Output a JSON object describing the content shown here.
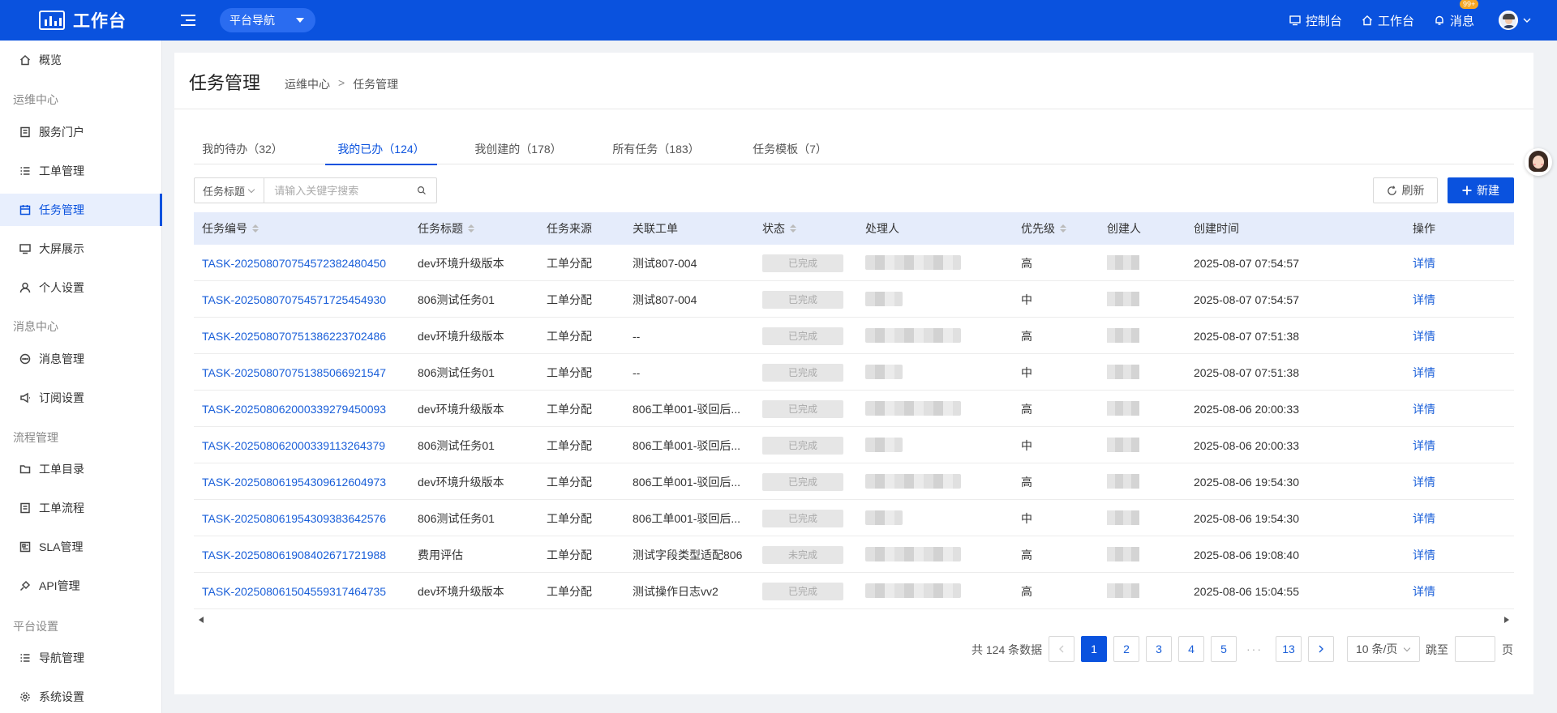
{
  "header": {
    "brand": "工作台",
    "platform_nav": "平台导航",
    "links": [
      {
        "label": "控制台",
        "icon": "monitor-icon"
      },
      {
        "label": "工作台",
        "icon": "home-icon"
      },
      {
        "label": "消息",
        "icon": "bell-icon",
        "badge": "99+"
      }
    ],
    "brand_color": "#0a52de"
  },
  "sidebar": {
    "overview": "概览",
    "groups": [
      {
        "title": "运维中心",
        "items": [
          "服务门户",
          "工单管理",
          "任务管理",
          "大屏展示",
          "个人设置"
        ]
      },
      {
        "title": "消息中心",
        "items": [
          "消息管理",
          "订阅设置"
        ]
      },
      {
        "title": "流程管理",
        "items": [
          "工单目录",
          "工单流程",
          "SLA管理",
          "API管理"
        ]
      },
      {
        "title": "平台设置",
        "items": [
          "导航管理",
          "系统设置"
        ]
      }
    ],
    "active": "任务管理"
  },
  "page": {
    "title": "任务管理",
    "breadcrumb": [
      "运维中心",
      ">",
      "任务管理"
    ]
  },
  "tabs": [
    "我的待办（32）",
    "我的已办（124）",
    "我创建的（178）",
    "所有任务（183）",
    "任务模板（7）"
  ],
  "active_tab": 1,
  "filter": {
    "field": "任务标题",
    "placeholder": "请输入关键字搜索"
  },
  "actions": {
    "refresh": "刷新",
    "new": "新建"
  },
  "table": {
    "columns": [
      "任务编号",
      "任务标题",
      "任务来源",
      "关联工单",
      "状态",
      "处理人",
      "优先级",
      "创建人",
      "创建时间",
      "操作"
    ],
    "rows": [
      {
        "id": "TASK-20250807075457238248045 0",
        "title": "dev环境升级版本",
        "source": "工单分配",
        "ticket": "测试807-004",
        "status": "已完成",
        "priority": "高",
        "time": "2025-08-07 07:54:57",
        "action": "详情"
      },
      {
        "id": "TASK-20250807075457172545493 0",
        "title": "806测试任务01",
        "source": "工单分配",
        "ticket": "测试807-004",
        "status": "已完成",
        "priority": "中",
        "time": "2025-08-07 07:54:57",
        "action": "详情"
      },
      {
        "id": "TASK-20250807075138622370248 6",
        "title": "dev环境升级版本",
        "source": "工单分配",
        "ticket": "--",
        "status": "已完成",
        "priority": "高",
        "time": "2025-08-07 07:51:38",
        "action": "详情"
      },
      {
        "id": "TASK-20250807075138506692154 7",
        "title": "806测试任务01",
        "source": "工单分配",
        "ticket": "--",
        "status": "已完成",
        "priority": "中",
        "time": "2025-08-07 07:51:38",
        "action": "详情"
      },
      {
        "id": "TASK-20250806200033927945009 3",
        "title": "dev环境升级版本",
        "source": "工单分配",
        "ticket": "806工单001-驳回后...",
        "status": "已完成",
        "priority": "高",
        "time": "2025-08-06 20:00:33",
        "action": "详情"
      },
      {
        "id": "TASK-20250806200033911326437 9",
        "title": "806测试任务01",
        "source": "工单分配",
        "ticket": "806工单001-驳回后...",
        "status": "已完成",
        "priority": "中",
        "time": "2025-08-06 20:00:33",
        "action": "详情"
      },
      {
        "id": "TASK-20250806195430961260497 3",
        "title": "dev环境升级版本",
        "source": "工单分配",
        "ticket": "806工单001-驳回后...",
        "status": "已完成",
        "priority": "高",
        "time": "2025-08-06 19:54:30",
        "action": "详情"
      },
      {
        "id": "TASK-20250806195430938364257 6",
        "title": "806测试任务01",
        "source": "工单分配",
        "ticket": "806工单001-驳回后...",
        "status": "已完成",
        "priority": "中",
        "time": "2025-08-06 19:54:30",
        "action": "详情"
      },
      {
        "id": "TASK-20250806190840267172198 8",
        "title": "费用评估",
        "source": "工单分配",
        "ticket": "测试字段类型适配806",
        "status": "未完成",
        "priority": "高",
        "time": "2025-08-06 19:08:40",
        "action": "详情"
      },
      {
        "id": "TASK-20250806150455931746473 5",
        "title": "dev环境升级版本",
        "source": "工单分配",
        "ticket": "测试操作日志vv2",
        "status": "已完成",
        "priority": "高",
        "time": "2025-08-06 15:04:55",
        "action": "详情"
      }
    ]
  },
  "pagination": {
    "total": "共 124 条数据",
    "pages": [
      "1",
      "2",
      "3",
      "4",
      "5"
    ],
    "dots": "···",
    "last": "13",
    "page_size": "10 条/页",
    "jump_to": "跳至",
    "page_unit": "页"
  }
}
